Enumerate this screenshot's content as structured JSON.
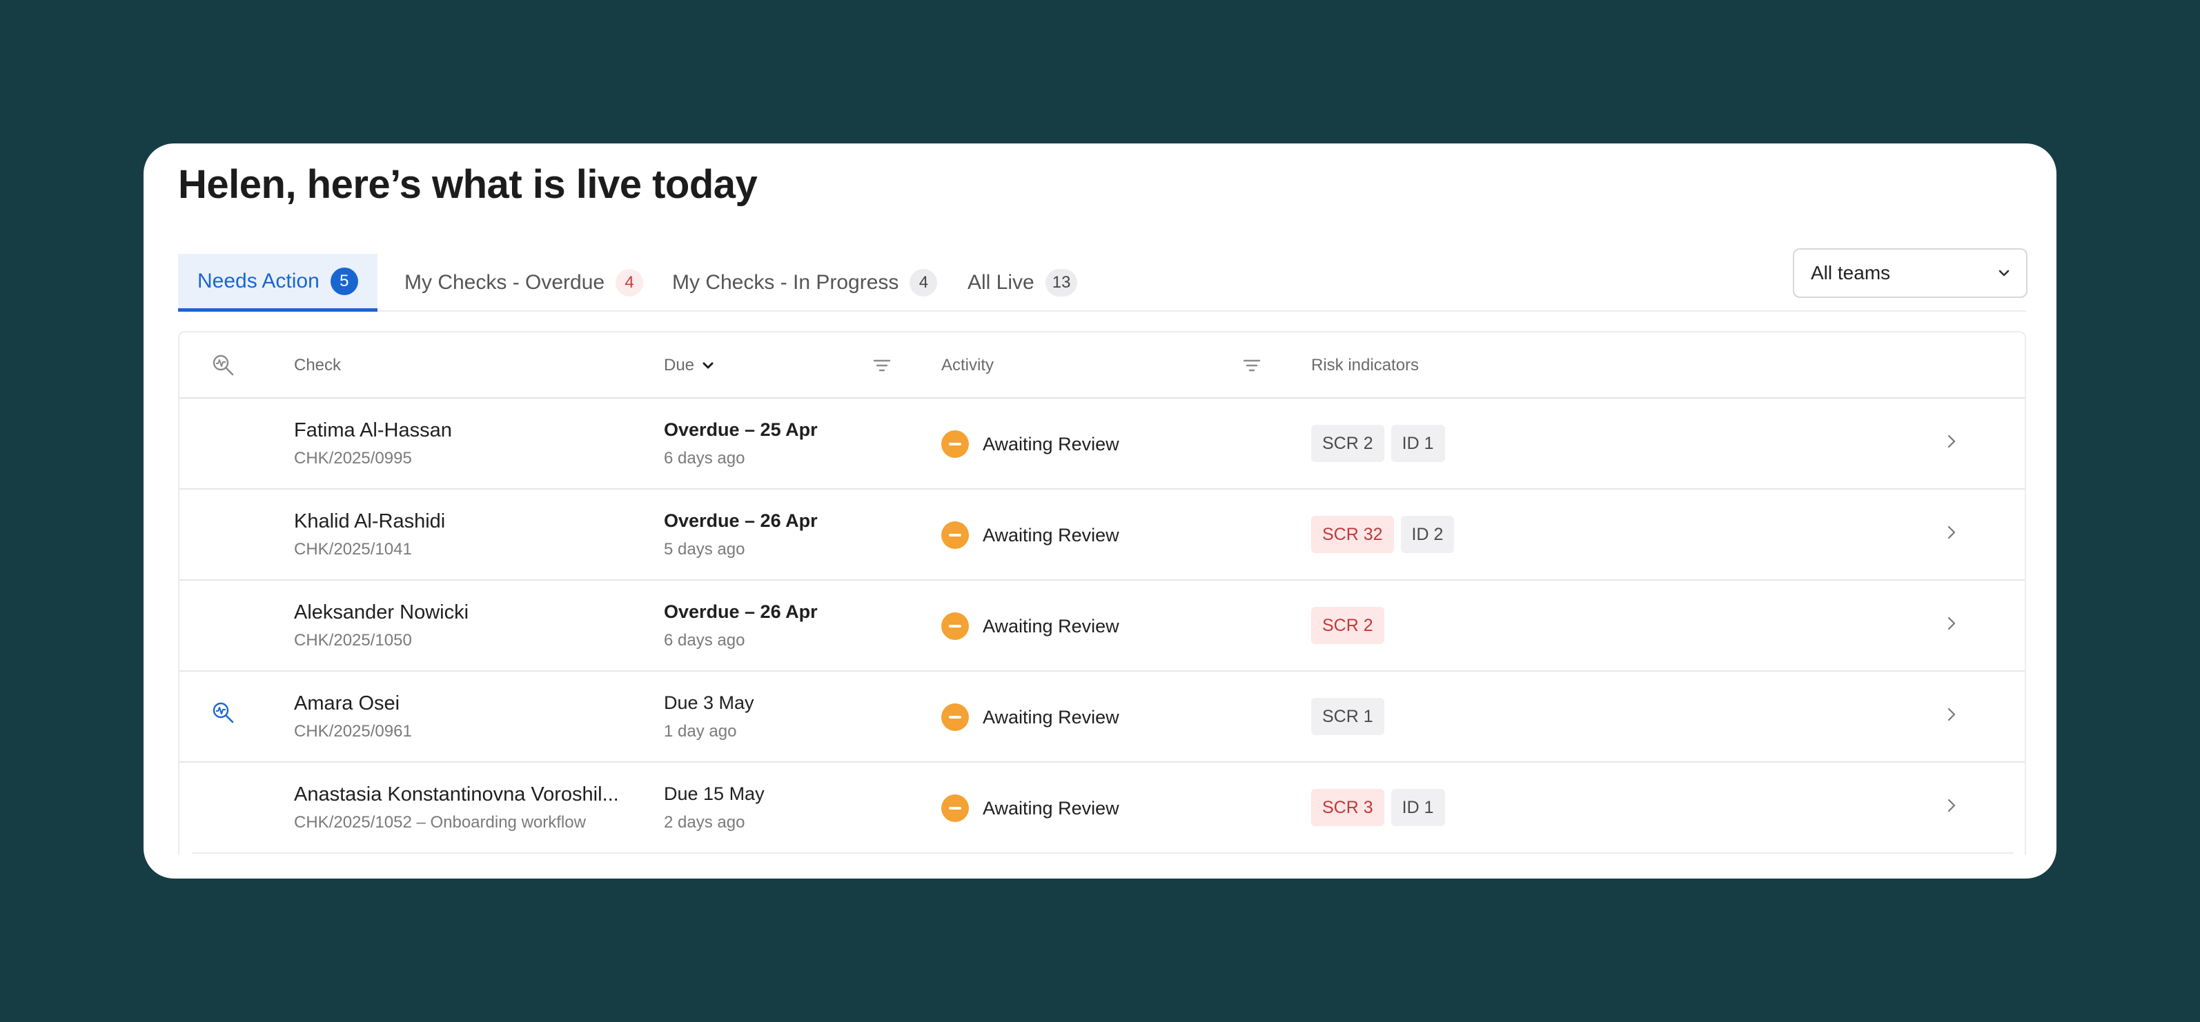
{
  "page": {
    "title": "Helen, here’s what is live today"
  },
  "tabs": [
    {
      "label": "Needs Action",
      "count": "5"
    },
    {
      "label": "My Checks - Overdue",
      "count": "4"
    },
    {
      "label": "My Checks - In Progress",
      "count": "4"
    },
    {
      "label": "All Live",
      "count": "13"
    }
  ],
  "team_filter": {
    "value": "All teams"
  },
  "table": {
    "columns": {
      "check": "Check",
      "due": "Due",
      "activity": "Activity",
      "risk": "Risk indicators"
    },
    "rows": [
      {
        "name": "Fatima Al-Hassan",
        "ref": "CHK/2025/0995",
        "due": "Overdue – 25 Apr",
        "due_ago": "6 days ago",
        "activity": "Awaiting Review",
        "badges": [
          {
            "label": "SCR 2",
            "level": "neutral"
          },
          {
            "label": "ID 1",
            "level": "neutral"
          }
        ]
      },
      {
        "name": "Khalid Al-Rashidi",
        "ref": "CHK/2025/1041",
        "due": "Overdue – 26 Apr",
        "due_ago": "5 days ago",
        "activity": "Awaiting Review",
        "badges": [
          {
            "label": "SCR 32",
            "level": "risk"
          },
          {
            "label": "ID 2",
            "level": "neutral"
          }
        ]
      },
      {
        "name": "Aleksander Nowicki",
        "ref": "CHK/2025/1050",
        "due": "Overdue – 26 Apr",
        "due_ago": "6 days ago",
        "activity": "Awaiting Review",
        "badges": [
          {
            "label": "SCR 2",
            "level": "risk"
          }
        ]
      },
      {
        "name": "Amara Osei",
        "ref": "CHK/2025/0961",
        "due": "Due 3 May",
        "due_ago": "1 day ago",
        "activity": "Awaiting Review",
        "badges": [
          {
            "label": "SCR 1",
            "level": "neutral"
          }
        ]
      },
      {
        "name": "Anastasia Konstantinovna Voroshil...",
        "ref": "CHK/2025/1052 – Onboarding workflow",
        "due": "Due 15 May",
        "due_ago": "2 days ago",
        "activity": "Awaiting Review",
        "badges": [
          {
            "label": "SCR 3",
            "level": "risk"
          },
          {
            "label": "ID 1",
            "level": "neutral"
          }
        ]
      }
    ]
  },
  "colors": {
    "background": "#173d44",
    "accent": "#1a66d0",
    "status_awaiting": "#f3a233",
    "risk_text": "#c0393b",
    "risk_bg": "#fde7e7"
  }
}
